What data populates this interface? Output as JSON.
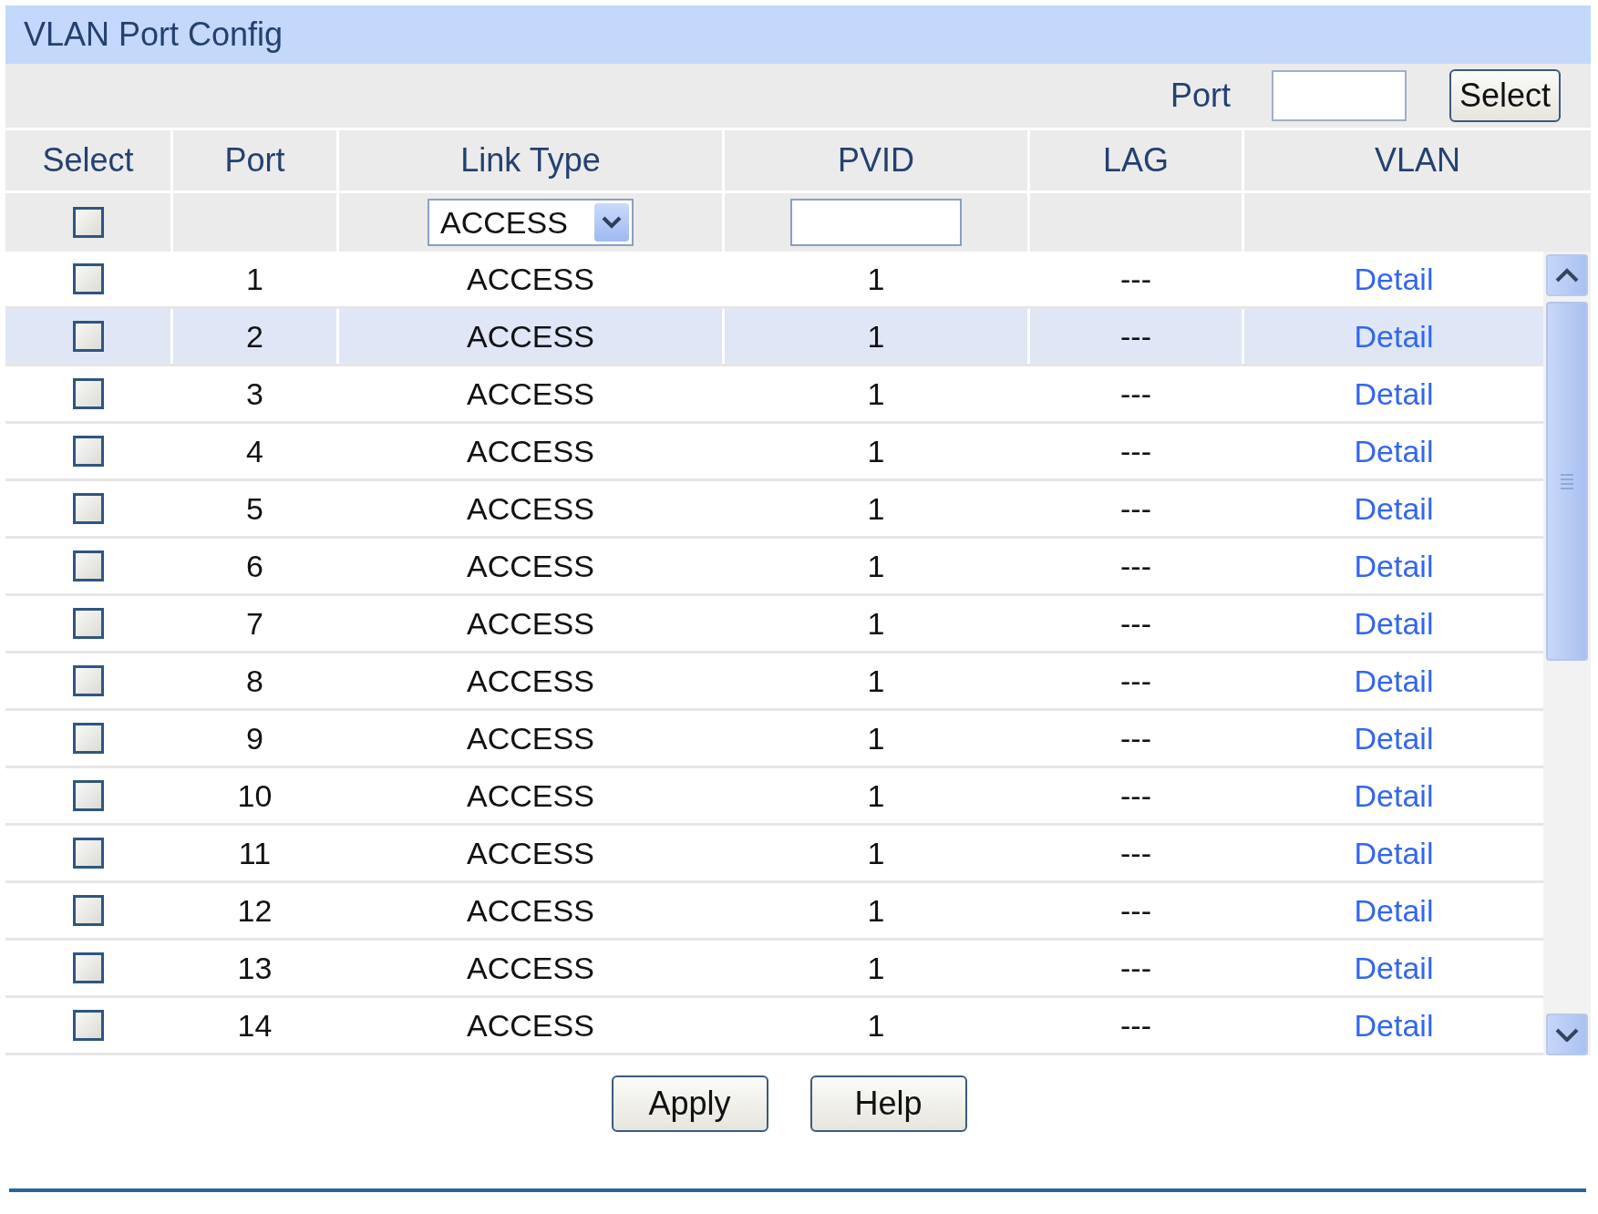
{
  "title": "VLAN Port Config",
  "port_filter": {
    "label": "Port",
    "button": "Select"
  },
  "table": {
    "columns": [
      "Select",
      "Port",
      "Link Type",
      "PVID",
      "LAG",
      "VLAN"
    ],
    "edit_row": {
      "select_all_checked": false,
      "link_type": "ACCESS"
    },
    "rows": [
      {
        "checked": false,
        "highlighted": false,
        "port": "1",
        "link_type": "ACCESS",
        "pvid": "1",
        "lag": "---",
        "vlan": "Detail"
      },
      {
        "checked": false,
        "highlighted": true,
        "port": "2",
        "link_type": "ACCESS",
        "pvid": "1",
        "lag": "---",
        "vlan": "Detail"
      },
      {
        "checked": false,
        "highlighted": false,
        "port": "3",
        "link_type": "ACCESS",
        "pvid": "1",
        "lag": "---",
        "vlan": "Detail"
      },
      {
        "checked": false,
        "highlighted": false,
        "port": "4",
        "link_type": "ACCESS",
        "pvid": "1",
        "lag": "---",
        "vlan": "Detail"
      },
      {
        "checked": false,
        "highlighted": false,
        "port": "5",
        "link_type": "ACCESS",
        "pvid": "1",
        "lag": "---",
        "vlan": "Detail"
      },
      {
        "checked": false,
        "highlighted": false,
        "port": "6",
        "link_type": "ACCESS",
        "pvid": "1",
        "lag": "---",
        "vlan": "Detail"
      },
      {
        "checked": false,
        "highlighted": false,
        "port": "7",
        "link_type": "ACCESS",
        "pvid": "1",
        "lag": "---",
        "vlan": "Detail"
      },
      {
        "checked": false,
        "highlighted": false,
        "port": "8",
        "link_type": "ACCESS",
        "pvid": "1",
        "lag": "---",
        "vlan": "Detail"
      },
      {
        "checked": false,
        "highlighted": false,
        "port": "9",
        "link_type": "ACCESS",
        "pvid": "1",
        "lag": "---",
        "vlan": "Detail"
      },
      {
        "checked": false,
        "highlighted": false,
        "port": "10",
        "link_type": "ACCESS",
        "pvid": "1",
        "lag": "---",
        "vlan": "Detail"
      },
      {
        "checked": false,
        "highlighted": false,
        "port": "11",
        "link_type": "ACCESS",
        "pvid": "1",
        "lag": "---",
        "vlan": "Detail"
      },
      {
        "checked": false,
        "highlighted": false,
        "port": "12",
        "link_type": "ACCESS",
        "pvid": "1",
        "lag": "---",
        "vlan": "Detail"
      },
      {
        "checked": false,
        "highlighted": false,
        "port": "13",
        "link_type": "ACCESS",
        "pvid": "1",
        "lag": "---",
        "vlan": "Detail"
      },
      {
        "checked": false,
        "highlighted": false,
        "port": "14",
        "link_type": "ACCESS",
        "pvid": "1",
        "lag": "---",
        "vlan": "Detail"
      }
    ]
  },
  "buttons": [
    "Apply",
    "Help"
  ]
}
